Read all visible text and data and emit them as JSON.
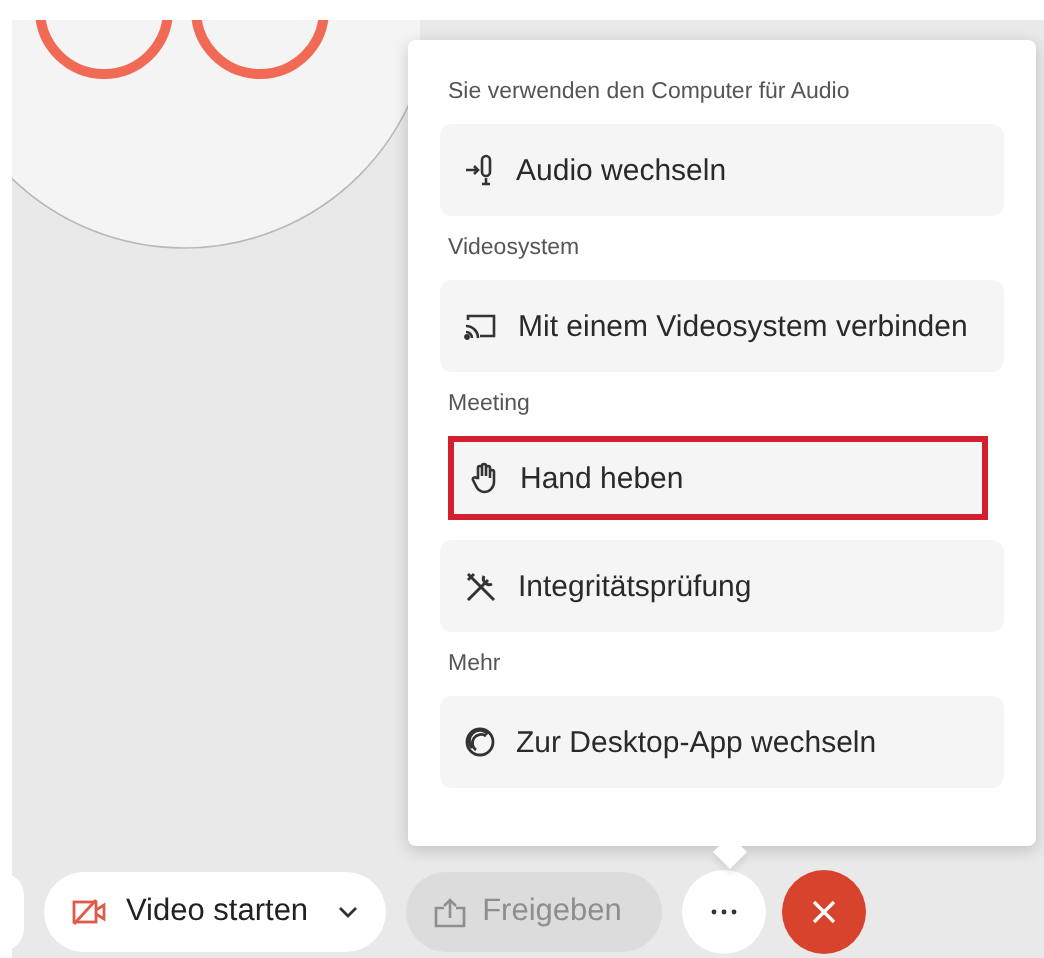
{
  "menu": {
    "sections": [
      {
        "heading": "Sie verwenden den Computer für Audio",
        "items": [
          {
            "label": "Audio wechseln",
            "highlighted": false
          }
        ]
      },
      {
        "heading": "Videosystem",
        "items": [
          {
            "label": "Mit einem Videosystem verbinden",
            "highlighted": false
          }
        ]
      },
      {
        "heading": "Meeting",
        "items": [
          {
            "label": "Hand heben",
            "highlighted": true
          },
          {
            "label": "Integritätsprüfung",
            "highlighted": false
          }
        ]
      },
      {
        "heading": "Mehr",
        "items": [
          {
            "label": "Zur Desktop-App wechseln",
            "highlighted": false
          }
        ]
      }
    ]
  },
  "toolbar": {
    "video_button": {
      "label": "Video starten"
    },
    "share_button": {
      "label": "Freigeben",
      "disabled": true
    }
  }
}
